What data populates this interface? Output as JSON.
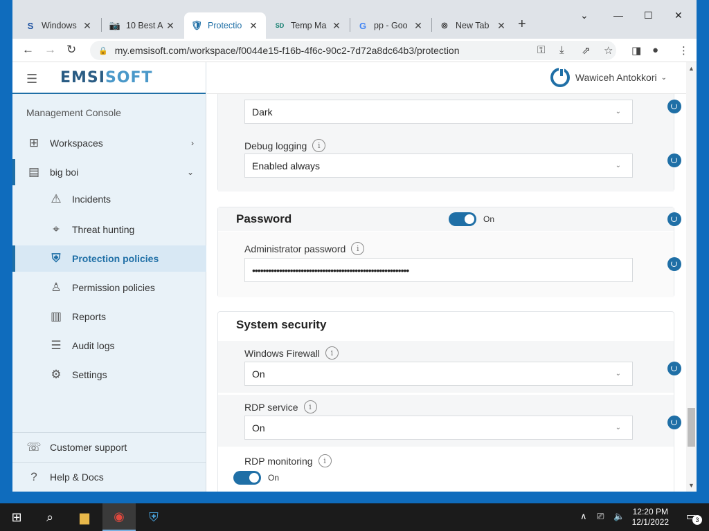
{
  "browser": {
    "tabs": [
      {
        "label": "Windows",
        "icon": "S"
      },
      {
        "label": "10 Best A",
        "icon": "📷"
      },
      {
        "label": "Protectio",
        "icon": "🛡"
      },
      {
        "label": "Temp Ma",
        "icon": "SD"
      },
      {
        "label": "pp - Goo",
        "icon": "G"
      },
      {
        "label": "New Tab",
        "icon": "⊚"
      }
    ],
    "url": "my.emsisoft.com/workspace/f0044e15-f16b-4f6c-90c2-7d72a8dc64b3/protection"
  },
  "sidebar": {
    "brand_a": "EMSI",
    "brand_b": "SOFT",
    "section": "Management Console",
    "items": [
      {
        "label": "Workspaces",
        "icon": "⊞"
      },
      {
        "label": "big boi",
        "icon": "▤"
      },
      {
        "label": "Incidents",
        "icon": "⚠"
      },
      {
        "label": "Threat hunting",
        "icon": "⌖"
      },
      {
        "label": "Protection policies",
        "icon": "⛨"
      },
      {
        "label": "Permission policies",
        "icon": "♙"
      },
      {
        "label": "Reports",
        "icon": "▥"
      },
      {
        "label": "Audit logs",
        "icon": "☰"
      },
      {
        "label": "Settings",
        "icon": "⚙"
      }
    ],
    "bottom": [
      {
        "label": "Customer support",
        "icon": "☏"
      },
      {
        "label": "Help & Docs",
        "icon": "?"
      }
    ]
  },
  "header": {
    "user": "Wawiceh Antokkori"
  },
  "content": {
    "appearance_value": "Dark",
    "debug_label": "Debug logging",
    "debug_value": "Enabled always",
    "password_title": "Password",
    "password_toggle": "On",
    "admin_pwd_label": "Administrator password",
    "admin_pwd_value": "••••••••••••••••••••••••••••••••••••••••••••••••••••••••••",
    "system_title": "System security",
    "firewall_label": "Windows Firewall",
    "firewall_value": "On",
    "rdp_label": "RDP service",
    "rdp_value": "On",
    "rdpmon_label": "RDP monitoring",
    "rdpmon_toggle": "On"
  },
  "taskbar": {
    "time": "12:20 PM",
    "date": "12/1/2022",
    "notif_count": "3"
  }
}
